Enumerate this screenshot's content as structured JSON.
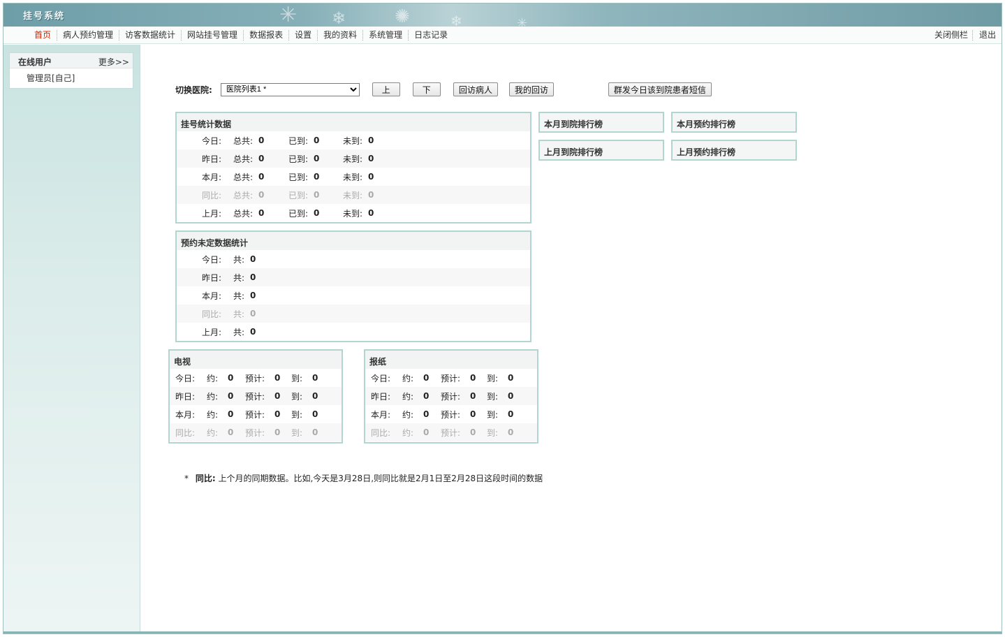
{
  "app": {
    "title": "挂号系统"
  },
  "menu": {
    "items": [
      "首页",
      "病人预约管理",
      "访客数据统计",
      "网站挂号管理",
      "数据报表",
      "设置",
      "我的资料",
      "系统管理",
      "日志记录"
    ],
    "right": [
      "关闭侧栏",
      "退出"
    ]
  },
  "sidebar": {
    "online_title": "在线用户",
    "more": "更多>>",
    "user": "管理员[自己]"
  },
  "toolbar": {
    "label": "切换医院:",
    "select_value": "医院列表1 *",
    "up": "上",
    "down": "下",
    "revisit_patient": "回访病人",
    "my_revisit": "我的回访",
    "sms": "群发今日该到院患者短信"
  },
  "stats": {
    "title": "挂号统计数据",
    "total_label": "总共:",
    "arrived_label": "已到:",
    "not_arrived_label": "未到:",
    "rows": [
      {
        "label": "今日:",
        "total": "0",
        "arrived": "0",
        "not_arrived": "0"
      },
      {
        "label": "昨日:",
        "total": "0",
        "arrived": "0",
        "not_arrived": "0"
      },
      {
        "label": "本月:",
        "total": "0",
        "arrived": "0",
        "not_arrived": "0"
      },
      {
        "label": "同比:",
        "total": "0",
        "arrived": "0",
        "not_arrived": "0"
      },
      {
        "label": "上月:",
        "total": "0",
        "arrived": "0",
        "not_arrived": "0"
      }
    ]
  },
  "pending": {
    "title": "预约未定数据统计",
    "total_label": "共:",
    "rows": [
      {
        "label": "今日:",
        "total": "0"
      },
      {
        "label": "昨日:",
        "total": "0"
      },
      {
        "label": "本月:",
        "total": "0"
      },
      {
        "label": "同比:",
        "total": "0"
      },
      {
        "label": "上月:",
        "total": "0"
      }
    ]
  },
  "rankings": {
    "this_month_arrival": "本月到院排行榜",
    "this_month_booking": "本月预约排行榜",
    "last_month_arrival": "上月到院排行榜",
    "last_month_booking": "上月预约排行榜"
  },
  "media": {
    "booked_label": "约:",
    "expected_label": "预计:",
    "arrived_label": "到:",
    "tv": {
      "title": "电视",
      "rows": [
        {
          "label": "今日:",
          "booked": "0",
          "expected": "0",
          "arrived": "0"
        },
        {
          "label": "昨日:",
          "booked": "0",
          "expected": "0",
          "arrived": "0"
        },
        {
          "label": "本月:",
          "booked": "0",
          "expected": "0",
          "arrived": "0"
        },
        {
          "label": "同比:",
          "booked": "0",
          "expected": "0",
          "arrived": "0"
        }
      ]
    },
    "newspaper": {
      "title": "报纸",
      "rows": [
        {
          "label": "今日:",
          "booked": "0",
          "expected": "0",
          "arrived": "0"
        },
        {
          "label": "昨日:",
          "booked": "0",
          "expected": "0",
          "arrived": "0"
        },
        {
          "label": "本月:",
          "booked": "0",
          "expected": "0",
          "arrived": "0"
        },
        {
          "label": "同比:",
          "booked": "0",
          "expected": "0",
          "arrived": "0"
        }
      ]
    }
  },
  "note": {
    "star": "*",
    "term": "同比:",
    "text": "上个月的同期数据。比如,今天是3月28日,则同比就是2月1日至2月28日这段时间的数据"
  }
}
